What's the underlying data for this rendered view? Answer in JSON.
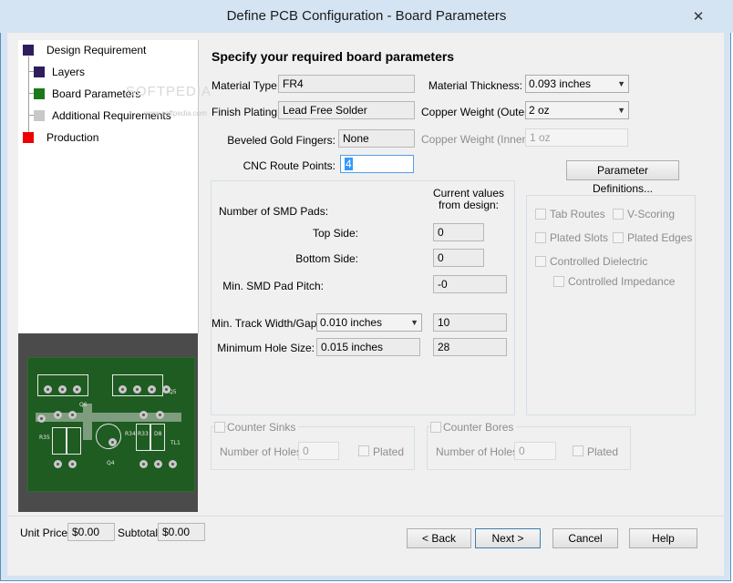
{
  "window": {
    "title": "Define PCB Configuration - Board Parameters",
    "close_glyph": "✕"
  },
  "nav": {
    "items": [
      {
        "label": "Design Requirement",
        "color": "#2e1e5e"
      },
      {
        "label": "Layers",
        "color": "#2e1e5e"
      },
      {
        "label": "Board Parameters",
        "color": "#1a7a1a"
      },
      {
        "label": "Additional Requirements",
        "color": "#c8c8c8"
      },
      {
        "label": "Production",
        "color": "#ee0000"
      }
    ],
    "watermark": "SOFTPEDIA",
    "watermark_url": "www.softpedia.com"
  },
  "preview": {
    "silk_labels": [
      "Q6",
      "Q5",
      "R35",
      "Q4",
      "R33",
      "R34",
      "D8",
      "TL1"
    ]
  },
  "main": {
    "heading": "Specify your required board parameters",
    "material_type": {
      "label": "Material Type:",
      "value": "FR4"
    },
    "finish_plating": {
      "label": "Finish Plating:",
      "value": "Lead Free Solder"
    },
    "beveled_gold": {
      "label": "Beveled Gold Fingers:",
      "value": "None"
    },
    "cnc_route": {
      "label": "CNC Route Points:",
      "value": "4"
    },
    "material_thickness": {
      "label": "Material Thickness:",
      "value": "0.093 inches"
    },
    "copper_outer": {
      "label": "Copper Weight (Outer):",
      "value": "2 oz"
    },
    "copper_inner": {
      "label": "Copper Weight (Inner):",
      "value": "1 oz"
    },
    "param_defs_button": "Parameter Definitions..."
  },
  "smd": {
    "header": "Current values\nfrom design:",
    "num_pads": "Number of SMD Pads:",
    "top_side": {
      "label": "Top Side:",
      "value": "0"
    },
    "bottom_side": {
      "label": "Bottom Side:",
      "value": "0"
    },
    "min_pitch": {
      "label": "Min. SMD Pad Pitch:",
      "value": "-0"
    },
    "track_width": {
      "label": "Min. Track Width/Gap:",
      "select": "0.010 inches",
      "value": "10"
    },
    "hole_size": {
      "label": "Minimum Hole Size:",
      "select": "0.015 inches",
      "value": "28"
    }
  },
  "options": {
    "tab_routes": "Tab Routes",
    "v_scoring": "V-Scoring",
    "plated_slots": "Plated Slots",
    "plated_edges": "Plated Edges",
    "controlled_dielectric": "Controlled Dielectric",
    "controlled_impedance": "Controlled Impedance"
  },
  "counter_sinks": {
    "label": "Counter Sinks",
    "holes_label": "Number of Holes:",
    "holes_value": "0",
    "plated": "Plated"
  },
  "counter_bores": {
    "label": "Counter Bores",
    "holes_label": "Number of Holes:",
    "holes_value": "0",
    "plated": "Plated"
  },
  "footer": {
    "unit_price_label": "Unit Price:",
    "unit_price": "$0.00",
    "subtotal_label": "Subtotal:",
    "subtotal": "$0.00",
    "back": "< Back",
    "next": "Next >",
    "cancel": "Cancel",
    "help": "Help"
  }
}
